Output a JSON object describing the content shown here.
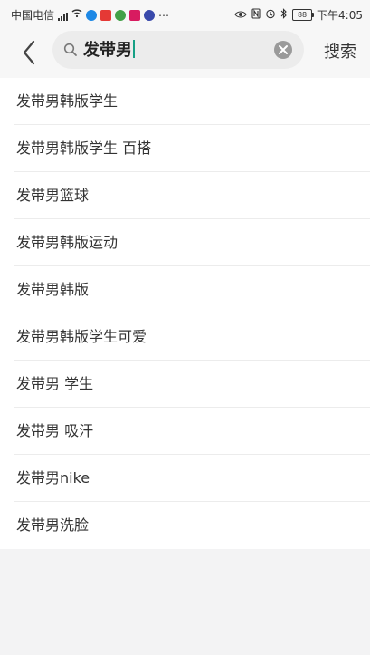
{
  "status_bar": {
    "carrier": "中国电信",
    "time": "下午4:05",
    "battery": "88"
  },
  "search": {
    "query": "发带男",
    "button_label": "搜索"
  },
  "suggestions": [
    "发带男韩版学生",
    "发带男韩版学生 百搭",
    "发带男篮球",
    "发带男韩版运动",
    "发带男韩版",
    "发带男韩版学生可爱",
    "发带男 学生",
    "发带男 吸汗",
    "发带男nike",
    "发带男洗脸"
  ],
  "colors": {
    "accent": "#16a085",
    "background": "#f3f3f4",
    "panel": "#ffffff"
  }
}
